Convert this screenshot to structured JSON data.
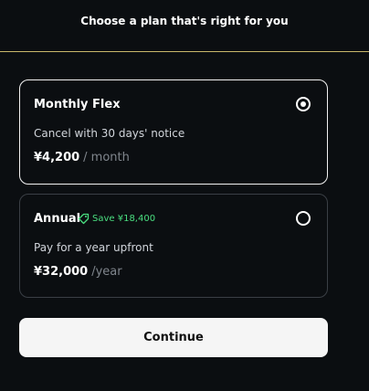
{
  "header": {
    "title": "Choose a plan that's right for you"
  },
  "plans": [
    {
      "name": "Monthly Flex",
      "description": "Cancel with 30 days' notice",
      "price": "¥4,200",
      "period": "/ month",
      "selected": true
    },
    {
      "name": "Annual",
      "badge": "Save ¥18,400",
      "badge_icon": "tag-icon",
      "description": "Pay for a year upfront",
      "price": "¥32,000",
      "period": "/year",
      "selected": false
    }
  ],
  "actions": {
    "continue_label": "Continue"
  },
  "colors": {
    "background": "#0b0e11",
    "accent_line": "#c9b86a",
    "save_green": "#4ade80",
    "button_bg": "#f5f5f5"
  }
}
